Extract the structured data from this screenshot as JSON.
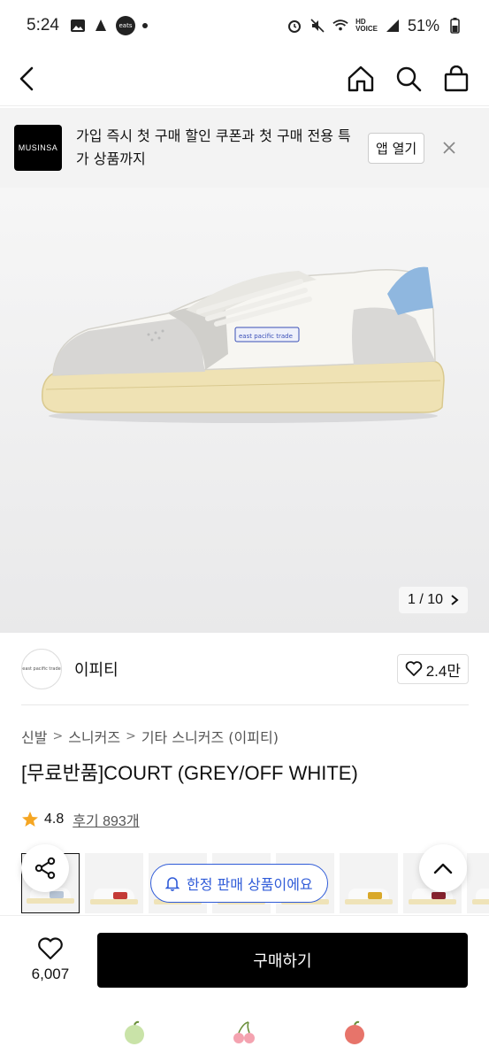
{
  "status_bar": {
    "time": "5:24",
    "eats_badge": "coupang eats",
    "hd_label": "HD VOICE",
    "battery": "51%"
  },
  "top_nav": {
    "icons": [
      "chevron-left-icon",
      "home-icon",
      "search-icon",
      "shopping-bag-icon"
    ]
  },
  "banner": {
    "logo_text": "MUSINSA",
    "message": "가입 즉시 첫 구매 할인 쿠폰과 첫 구매 전용 특가 상품까지",
    "open_label": "앱 열기"
  },
  "hero": {
    "shoe_label": "east pacific trade",
    "counter_current": "1",
    "counter_total": "10",
    "counter_text": "1 / 10"
  },
  "seller": {
    "avatar_text": "east pacific trade",
    "name": "이피티",
    "likes": "2.4만"
  },
  "breadcrumb": [
    "신발",
    "스니커즈",
    "기타 스니커즈 (이피티)"
  ],
  "product": {
    "title": "[무료반품]COURT (GREY/OFF WHITE)",
    "rating": "4.8",
    "reviews": "후기 893개"
  },
  "thumbnails": {
    "accents": [
      "#b9c7d8",
      "#c43a36",
      "#8a2430",
      "#c43a36",
      "#d0d0d0",
      "#d9a829",
      "#8a2430",
      "#2f7a47"
    ]
  },
  "limited_badge": "한정 판매 상품이에요",
  "bottom_bar": {
    "wish_count": "6,007",
    "buy_label": "구매하기"
  },
  "colors": {
    "accent_blue": "#2f5bd8",
    "buy_button": "#000000"
  }
}
